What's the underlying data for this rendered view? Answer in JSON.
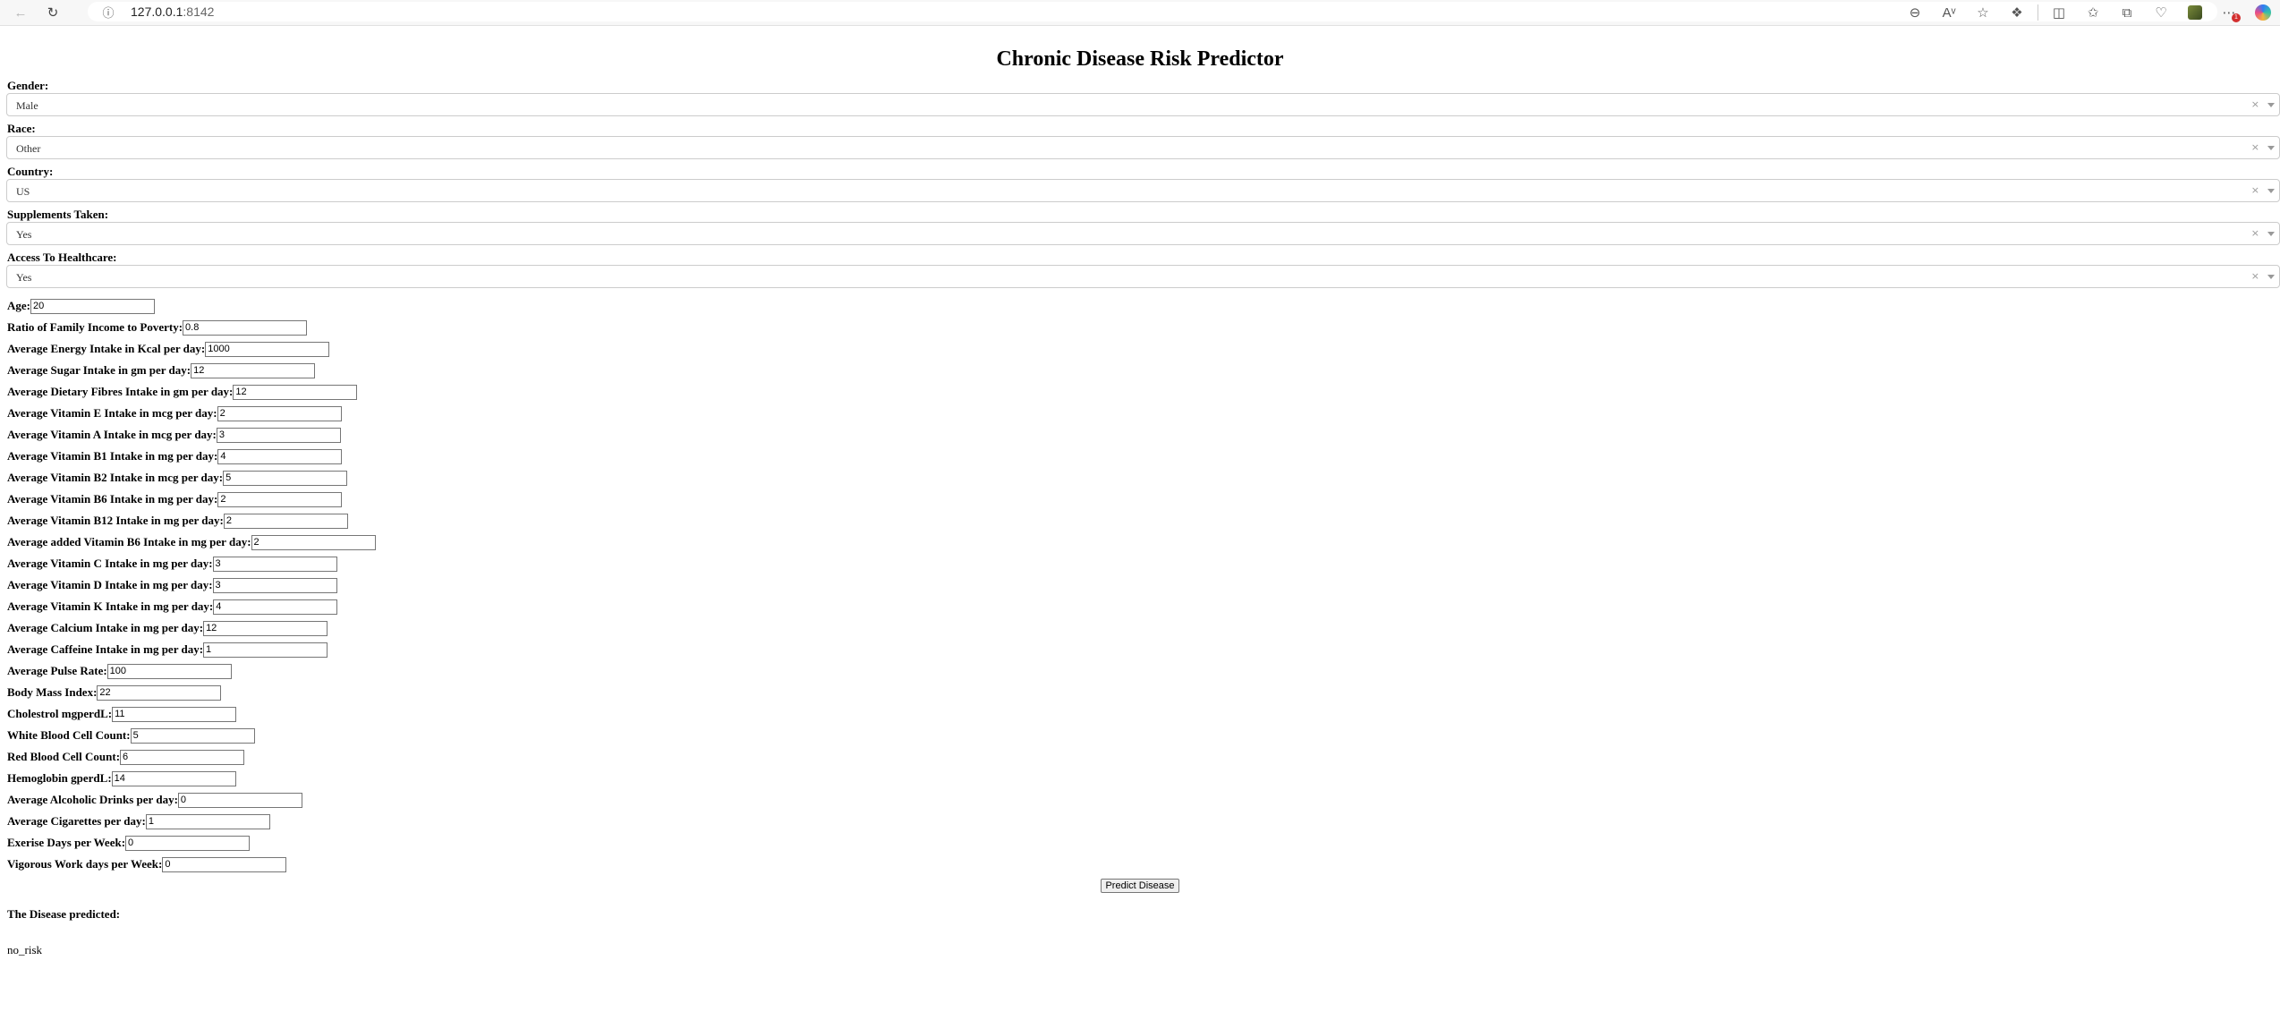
{
  "browser": {
    "url_host": "127.0.0.1",
    "url_port": ":8142"
  },
  "page": {
    "title": "Chronic Disease Risk Predictor"
  },
  "dropdowns": [
    {
      "label": "Gender:",
      "value": "Male"
    },
    {
      "label": "Race:",
      "value": "Other"
    },
    {
      "label": "Country:",
      "value": "US"
    },
    {
      "label": "Supplements Taken:",
      "value": "Yes"
    },
    {
      "label": "Access To Healthcare:",
      "value": "Yes"
    }
  ],
  "fields": [
    {
      "label": "Age:",
      "value": "20"
    },
    {
      "label": "Ratio of Family Income to Poverty:",
      "value": "0.8"
    },
    {
      "label": "Average Energy Intake in Kcal per day:",
      "value": "1000"
    },
    {
      "label": "Average Sugar Intake in gm per day:",
      "value": "12"
    },
    {
      "label": "Average Dietary Fibres Intake in gm per day:",
      "value": "12"
    },
    {
      "label": "Average Vitamin E Intake in mcg per day:",
      "value": "2"
    },
    {
      "label": "Average Vitamin A Intake in mcg per day:",
      "value": "3"
    },
    {
      "label": "Average Vitamin B1 Intake in mg per day:",
      "value": "4"
    },
    {
      "label": "Average Vitamin B2 Intake in mcg per day:",
      "value": "5"
    },
    {
      "label": "Average Vitamin B6 Intake in mg per day:",
      "value": "2"
    },
    {
      "label": "Average Vitamin B12 Intake in mg per day:",
      "value": "2"
    },
    {
      "label": "Average added Vitamin B6 Intake in mg per day:",
      "value": "2"
    },
    {
      "label": "Average Vitamin C Intake in mg per day:",
      "value": "3"
    },
    {
      "label": "Average Vitamin D Intake in mg per day:",
      "value": "3"
    },
    {
      "label": "Average Vitamin K Intake in mg per day:",
      "value": "4"
    },
    {
      "label": "Average Calcium Intake in mg per day:",
      "value": "12"
    },
    {
      "label": "Average Caffeine Intake in mg per day:",
      "value": "1"
    },
    {
      "label": "Average Pulse Rate:",
      "value": "100"
    },
    {
      "label": "Body Mass Index:",
      "value": "22"
    },
    {
      "label": "Cholestrol mgperdL:",
      "value": "11"
    },
    {
      "label": "White Blood Cell Count:",
      "value": "5"
    },
    {
      "label": "Red Blood Cell Count:",
      "value": "6"
    },
    {
      "label": "Hemoglobin gperdL:",
      "value": "14"
    },
    {
      "label": "Average Alcoholic Drinks per day:",
      "value": "0"
    },
    {
      "label": "Average Cigarettes per day:",
      "value": "1"
    },
    {
      "label": "Exerise Days per Week:",
      "value": "0"
    },
    {
      "label": "Vigorous Work days per Week:",
      "value": "0"
    }
  ],
  "predict_button": "Predict Disease",
  "result": {
    "label": "The Disease predicted:",
    "value": "no_risk"
  },
  "icons": {
    "back": "back-arrow-icon",
    "reload": "reload-icon",
    "site_info": "info-icon",
    "zoom": "zoom-out-icon",
    "read_aloud": "read-aloud-icon",
    "favorite": "star-icon",
    "extensions": "puzzle-icon",
    "split": "split-screen-icon",
    "favorites_bar": "favorites-icon",
    "collections": "collections-icon",
    "performance": "heart-pulse-icon",
    "profile": "profile-icon",
    "more": "more-icon",
    "copilot": "copilot-icon"
  },
  "colors": {
    "chrome_bg": "#f7f7f7",
    "badge": "#d32f2f"
  }
}
